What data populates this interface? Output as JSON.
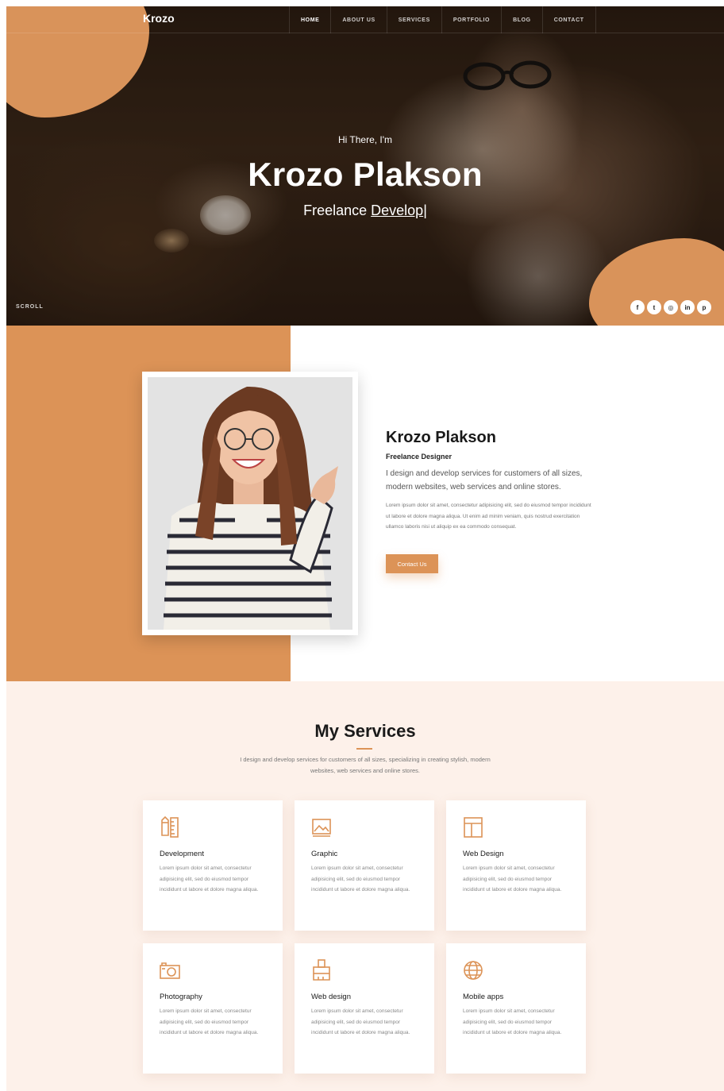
{
  "nav": {
    "brand": "Krozo",
    "items": [
      {
        "label": "HOME",
        "active": true
      },
      {
        "label": "ABOUT US",
        "active": false
      },
      {
        "label": "SERVICES",
        "active": false
      },
      {
        "label": "PORTFOLIO",
        "active": false
      },
      {
        "label": "BLOG",
        "active": false
      },
      {
        "label": "CONTACT",
        "active": false
      }
    ]
  },
  "hero": {
    "greeting": "Hi There, I'm",
    "name": "Krozo Plakson",
    "role_prefix": "Freelance",
    "role_typed": "Develop",
    "role_cursor": "|",
    "scroll_label": "SCROLL",
    "socials": [
      {
        "icon": "facebook-icon",
        "glyph": "f"
      },
      {
        "icon": "twitter-icon",
        "glyph": "t"
      },
      {
        "icon": "instagram-icon",
        "glyph": "◎"
      },
      {
        "icon": "linkedin-icon",
        "glyph": "in"
      },
      {
        "icon": "pinterest-icon",
        "glyph": "p"
      }
    ]
  },
  "about": {
    "name": "Krozo Plakson",
    "subtitle": "Freelance Designer",
    "lead": "I design and develop services for customers of all sizes, modern websites, web services and online stores.",
    "body": "Lorem ipsum dolor sit amet, consectetur adipisicing elit, sed do eiusmod tempor incididunt ut labore et dolore magna aliqua. Ut enim ad minim veniam, quis nostrud exercitation ullamco laboris nisi ut aliquip ex ea commodo consequat.",
    "button": "Contact Us"
  },
  "services": {
    "title": "My Services",
    "description": "I design and develop services for customers of all sizes, specializing in creating stylish, modern websites, web services and online stores.",
    "items": [
      {
        "title": "Development",
        "icon": "ruler-pencil-icon",
        "text": "Lorem ipsum dolor sit amet, consectetur adipisicing elit, sed do eiusmod tempor incididunt ut labore et dolore magna aliqua."
      },
      {
        "title": "Graphic",
        "icon": "image-icon",
        "text": "Lorem ipsum dolor sit amet, consectetur adipisicing elit, sed do eiusmod tempor incididunt ut labore et dolore magna aliqua."
      },
      {
        "title": "Web Design",
        "icon": "layout-icon",
        "text": "Lorem ipsum dolor sit amet, consectetur adipisicing elit, sed do eiusmod tempor incididunt ut labore et dolore magna aliqua."
      },
      {
        "title": "Photography",
        "icon": "camera-icon",
        "text": "Lorem ipsum dolor sit amet, consectetur adipisicing elit, sed do eiusmod tempor incididunt ut labore et dolore magna aliqua."
      },
      {
        "title": "Web design",
        "icon": "paint-brush-icon",
        "text": "Lorem ipsum dolor sit amet, consectetur adipisicing elit, sed do eiusmod tempor incididunt ut labore et dolore magna aliqua."
      },
      {
        "title": "Mobile apps",
        "icon": "globe-icon",
        "text": "Lorem ipsum dolor sit amet, consectetur adipisicing elit, sed do eiusmod tempor incididunt ut labore et dolore magna aliqua."
      }
    ]
  },
  "colors": {
    "accent": "#dc9357",
    "services_background": "#fdf1ea",
    "hero_dark": "#2b1d12"
  }
}
